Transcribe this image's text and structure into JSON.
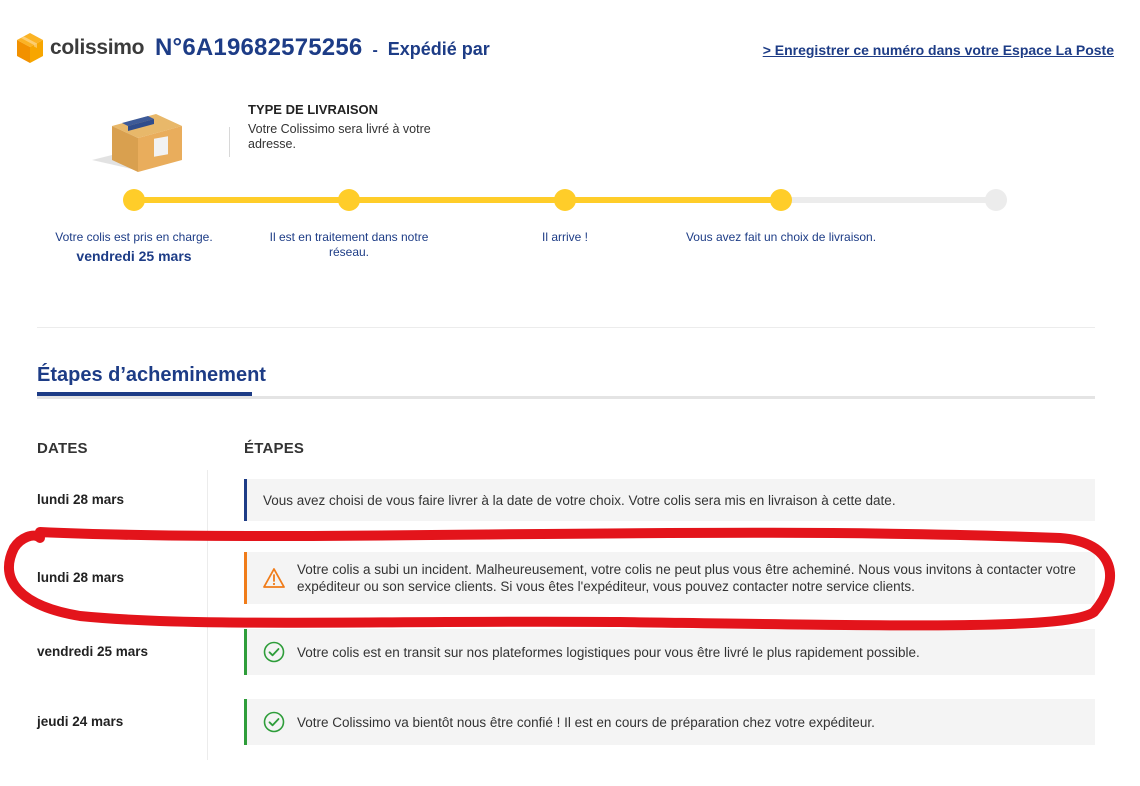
{
  "header": {
    "brand_name": "colissimo",
    "tracking_number": "N°6A19682575256",
    "separator": "-",
    "status": "Expédié par",
    "register_link": "> Enregistrer ce numéro dans votre Espace La Poste"
  },
  "delivery": {
    "title": "TYPE DE LIVRAISON",
    "text": "Votre Colissimo sera livré à votre adresse."
  },
  "progress": {
    "completed_steps": 4,
    "total_steps": 5,
    "steps": [
      {
        "label": "Votre colis est pris en charge.",
        "date": "vendredi 25 mars"
      },
      {
        "label": "Il est en traitement dans notre réseau.",
        "date": ""
      },
      {
        "label": "Il arrive !",
        "date": ""
      },
      {
        "label": "Vous avez fait un choix de livraison.",
        "date": ""
      },
      {
        "label": "",
        "date": ""
      }
    ]
  },
  "section": {
    "title": "Étapes d’acheminement"
  },
  "table": {
    "col_dates": "DATES",
    "col_steps": "ÉTAPES",
    "rows": [
      {
        "date": "lundi 28 mars",
        "type": "info",
        "text": "Vous avez choisi de vous faire livrer à la date de votre choix. Votre colis sera mis en livraison à cette date."
      },
      {
        "date": "lundi 28 mars",
        "type": "warning",
        "text": "Votre colis a subi un incident. Malheureusement, votre colis ne peut plus vous être acheminé. Nous vous invitons à contacter votre expéditeur ou son service clients. Si vous êtes l'expéditeur, vous pouvez contacter notre service clients."
      },
      {
        "date": "vendredi 25 mars",
        "type": "success",
        "text": "Votre colis est en transit sur nos plateformes logistiques pour vous être livré le plus rapidement possible."
      },
      {
        "date": "jeudi 24 mars",
        "type": "success",
        "text": "Votre Colissimo va bientôt nous être confié ! Il est en cours de préparation chez votre expéditeur."
      }
    ]
  },
  "icons": {
    "logo": "colissimo-box-icon",
    "delivery": "parcel-box-icon",
    "warning": "warning-triangle-icon",
    "success": "check-circle-icon"
  },
  "colors": {
    "brand_blue": "#1d3c86",
    "progress_yellow": "#ffcd29",
    "warning_orange": "#f07c1a",
    "success_green": "#2e9d3a",
    "annotation_red": "#e3141b"
  }
}
